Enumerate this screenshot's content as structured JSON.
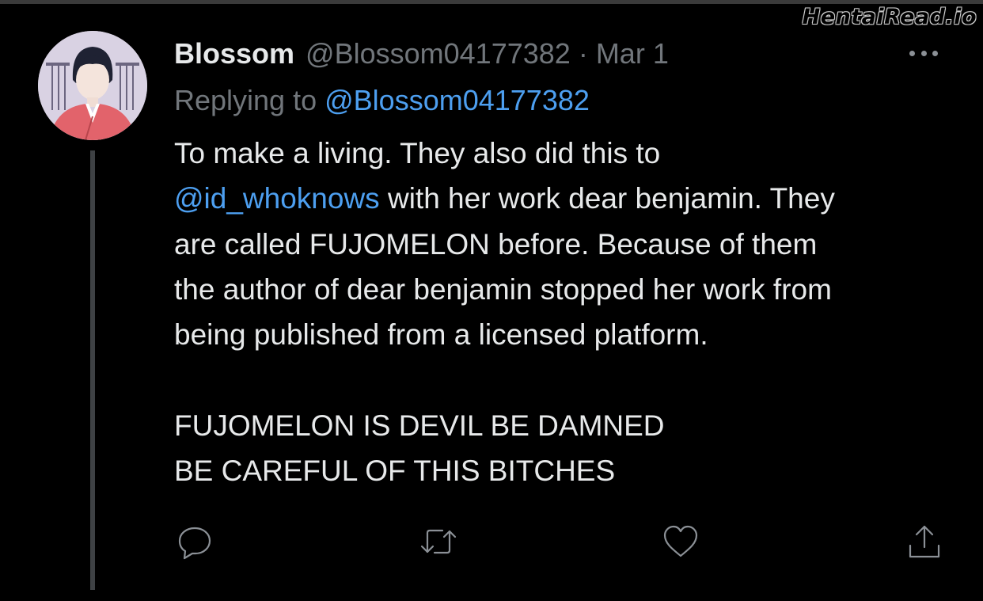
{
  "watermark": "HentaiRead.io",
  "tweet": {
    "author_name": "Blossom",
    "author_handle": "@Blossom04177382",
    "separator": "·",
    "date": "Mar 1",
    "replying_prefix": "Replying to",
    "replying_handle": "@Blossom04177382",
    "body": {
      "line1": "To make a living. They also did this to",
      "mention": "@id_whoknows",
      "line2_rest": " with her work dear benjamin. They",
      "line3": "are called FUJOMELON before. Because of them",
      "line4": "the author of dear benjamin stopped her work from",
      "line5": "being published from a licensed platform.",
      "line6": "FUJOMELON IS DEVIL BE DAMNED",
      "line7": "BE CAREFUL OF THIS BITCHES"
    },
    "actions": [
      "reply-icon",
      "retweet-icon",
      "like-icon",
      "share-icon"
    ]
  },
  "colors": {
    "background": "#000000",
    "text": "#e7e9ea",
    "muted": "#71767b",
    "link": "#4d9ff0",
    "thread_line": "#3e4144"
  }
}
